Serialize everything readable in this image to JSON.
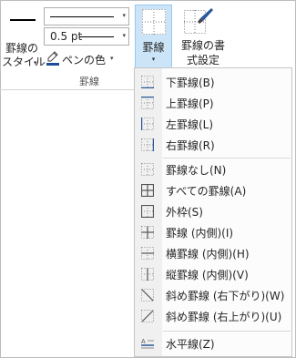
{
  "ribbon": {
    "border_style_label": "罫線の\nスタイル",
    "line_weight": "0.5 pt",
    "pen_color_label": "ペンの色",
    "group_label": "罫線",
    "borders_label": "罫線",
    "border_painter_label": "罫線の書\n式設定"
  },
  "menu": {
    "items": [
      {
        "label": "下罫線(B)",
        "icon": "bottom-border-icon"
      },
      {
        "label": "上罫線(P)",
        "icon": "top-border-icon"
      },
      {
        "label": "左罫線(L)",
        "icon": "left-border-icon"
      },
      {
        "label": "右罫線(R)",
        "icon": "right-border-icon"
      },
      {
        "label": "罫線なし(N)",
        "icon": "no-border-icon"
      },
      {
        "label": "すべての罫線(A)",
        "icon": "all-borders-icon"
      },
      {
        "label": "外枠(S)",
        "icon": "outside-borders-icon"
      },
      {
        "label": "罫線 (内側)(I)",
        "icon": "inside-borders-icon"
      },
      {
        "label": "横罫線 (内側)(H)",
        "icon": "inside-horizontal-border-icon"
      },
      {
        "label": "縦罫線 (内側)(V)",
        "icon": "inside-vertical-border-icon"
      },
      {
        "label": "斜め罫線 (右下がり)(W)",
        "icon": "diagonal-down-border-icon"
      },
      {
        "label": "斜め罫線 (右上がり)(U)",
        "icon": "diagonal-up-border-icon"
      },
      {
        "label": "水平線(Z)",
        "icon": "horizontal-line-icon"
      }
    ]
  },
  "colors": {
    "pen_color": "#1e4e9a",
    "selected_button_bg": "#cce4f7",
    "icon_blue": "#2b579a"
  }
}
